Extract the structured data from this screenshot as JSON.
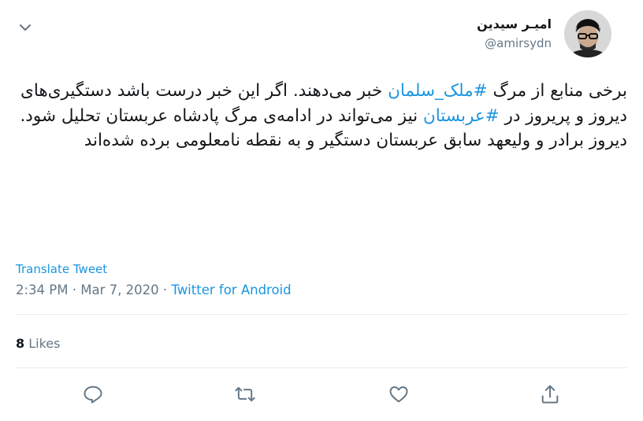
{
  "author": {
    "display_name": "امیـر سیدین",
    "handle": "@amirsydn"
  },
  "tweet": {
    "part1": "برخی منابع از مرگ ",
    "hashtag1": "#ملک_سلمان",
    "part2": " خبر می‌دهند. اگر این خبر درست باشد دستگیری‌های دیروز و پریروز در ",
    "hashtag2": "#عربستان",
    "part3": " نیز می‌تواند در ادامه‌ی مرگ پادشاه عربستان تحلیل شود.",
    "part4": "دیروز برادر و ولیعهد سابق عربستان دستگیر و به نقطه نامعلومی برده شده‌اند"
  },
  "translate_label": "Translate Tweet",
  "meta": {
    "time": "2:34 PM",
    "separator": "·",
    "date": "Mar 7, 2020",
    "source": "Twitter for Android"
  },
  "stats": {
    "likes_count": "8",
    "likes_label": "Likes"
  },
  "icons": {
    "caret": "chevron-down-icon",
    "reply": "reply-icon",
    "retweet": "retweet-icon",
    "like": "heart-icon",
    "share": "share-icon"
  },
  "colors": {
    "link": "#1b95e0",
    "secondary_text": "#657786",
    "primary_text": "#14171a",
    "divider": "#e6ecf0"
  }
}
